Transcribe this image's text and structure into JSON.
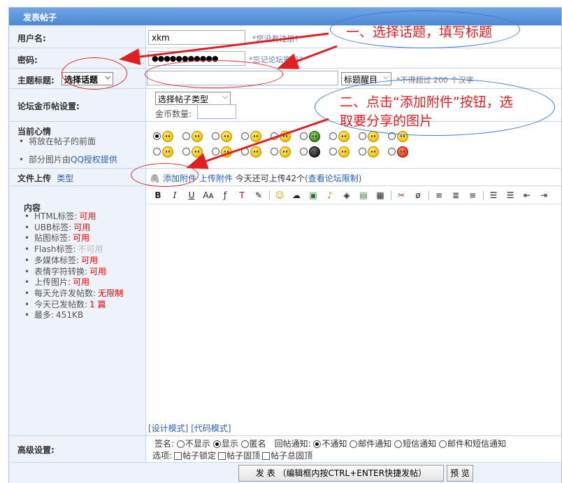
{
  "form_title": "发表帖子",
  "username": {
    "label": "用户名:",
    "value": "xkm",
    "hint": "*您没有注册?"
  },
  "password": {
    "label": "密码:",
    "value": "●●●●●●●●●●●",
    "hint": "*忘记论坛密码?"
  },
  "subject": {
    "label": "主题标题:",
    "topic_select": "选择话题",
    "title_value": "",
    "style_select": "标题醒目",
    "hint": "*不得超过 200 个汉字"
  },
  "gold": {
    "label": "论坛金币帖设置:",
    "type_select": "选择帖子类型",
    "amount_label": "金币数量:",
    "amount_value": ""
  },
  "mood": {
    "label": "当前心情",
    "note1": "将放在帖子的前面",
    "note2_prefix": "部分图片由",
    "note2_link": "QQ授权提供"
  },
  "upload": {
    "label": "文件上传",
    "type_link": "类型",
    "add_attachment": "添加附件",
    "upload_attachment": "上传附件",
    "remaining_text": "今天还可上传42个",
    "limit_link": "(查看论坛限制)"
  },
  "content": {
    "label": "内容",
    "rules": [
      {
        "name": "HTML标签:",
        "value": "可用",
        "status": "ok"
      },
      {
        "name": "UBB标签:",
        "value": "可用",
        "status": "ok"
      },
      {
        "name": "贴图标签:",
        "value": "可用",
        "status": "ok"
      },
      {
        "name": "Flash标签:",
        "value": "不可用",
        "status": "off"
      },
      {
        "name": "多媒体标签:",
        "value": "可用",
        "status": "ok"
      },
      {
        "name": "表情字符转换:",
        "value": "可用",
        "status": "ok"
      },
      {
        "name": "上传图片:",
        "value": "可用",
        "status": "ok"
      },
      {
        "name": "每天允许发帖数:",
        "value": "无限制",
        "status": "ok"
      },
      {
        "name": "今天已发帖数:",
        "value": "1 篇",
        "status": "ok"
      },
      {
        "name": "最多:",
        "value": "451KB",
        "status": "plain"
      }
    ],
    "design_mode": "[设计模式]",
    "code_mode": "[代码模式]",
    "toolbar_icons": [
      "bold-icon",
      "italic-icon",
      "underline-icon",
      "font-face-icon",
      "font-size-icon",
      "font-color-icon",
      "highlight-icon",
      "emoticon-icon",
      "link-icon",
      "image-icon",
      "music-icon",
      "media-icon",
      "table-icon",
      "sale-icon",
      "cut-icon",
      "strikethrough-icon",
      "align-left-icon",
      "align-center-icon",
      "align-right-icon",
      "ordered-list-icon",
      "unordered-list-icon",
      "outdent-icon",
      "indent-icon"
    ]
  },
  "advanced": {
    "label": "高级设置:",
    "sign_label": "签名:",
    "sign_options": [
      "不显示",
      "显示",
      "匿名"
    ],
    "sign_selected": 1,
    "notify_label": "回帖通知:",
    "notify_options": [
      "不通知",
      "邮件通知",
      "短信通知",
      "邮件和短信通知"
    ],
    "notify_selected": 0,
    "options_label": "选项:",
    "options": [
      "帖子锁定",
      "帖子固顶",
      "帖子总固顶"
    ]
  },
  "buttons": {
    "submit": "发 表 （编辑框内按CTRL+ENTER快捷发帖）",
    "preview": "预 览"
  },
  "annotations": {
    "step1": "一、选择话题，填写标题",
    "step2_line1": "二、点击“添加附件”按钮，选",
    "step2_line2": "取要分享的图片"
  },
  "colors": {
    "accent": "#4d89d4",
    "label_bg": "#eef3f9",
    "annotation": "#e02020"
  }
}
